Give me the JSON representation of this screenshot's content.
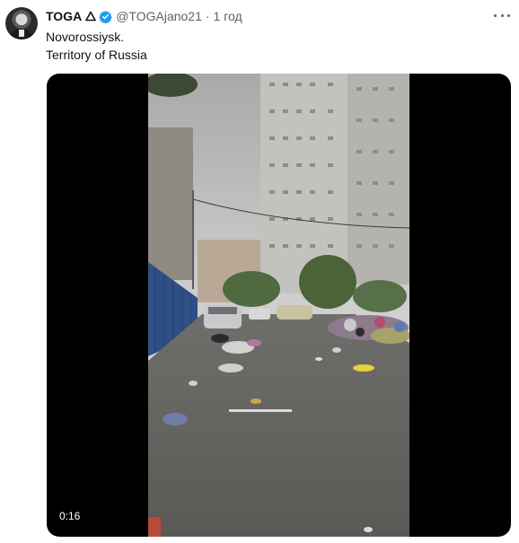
{
  "user": {
    "display_name": "TOGA",
    "name_badge_icon": "triangle-icon",
    "verified_icon": "verified-badge-icon",
    "handle": "@TOGAjano21",
    "separator": "·",
    "time_ago": "1 год"
  },
  "tweet": {
    "lines": [
      "Novorossiysk.",
      "Territory of Russia"
    ]
  },
  "media": {
    "type": "video",
    "duration": "0:16"
  },
  "colors": {
    "text_primary": "#0f1419",
    "text_secondary": "#536471",
    "verified": "#1d9bf0"
  }
}
